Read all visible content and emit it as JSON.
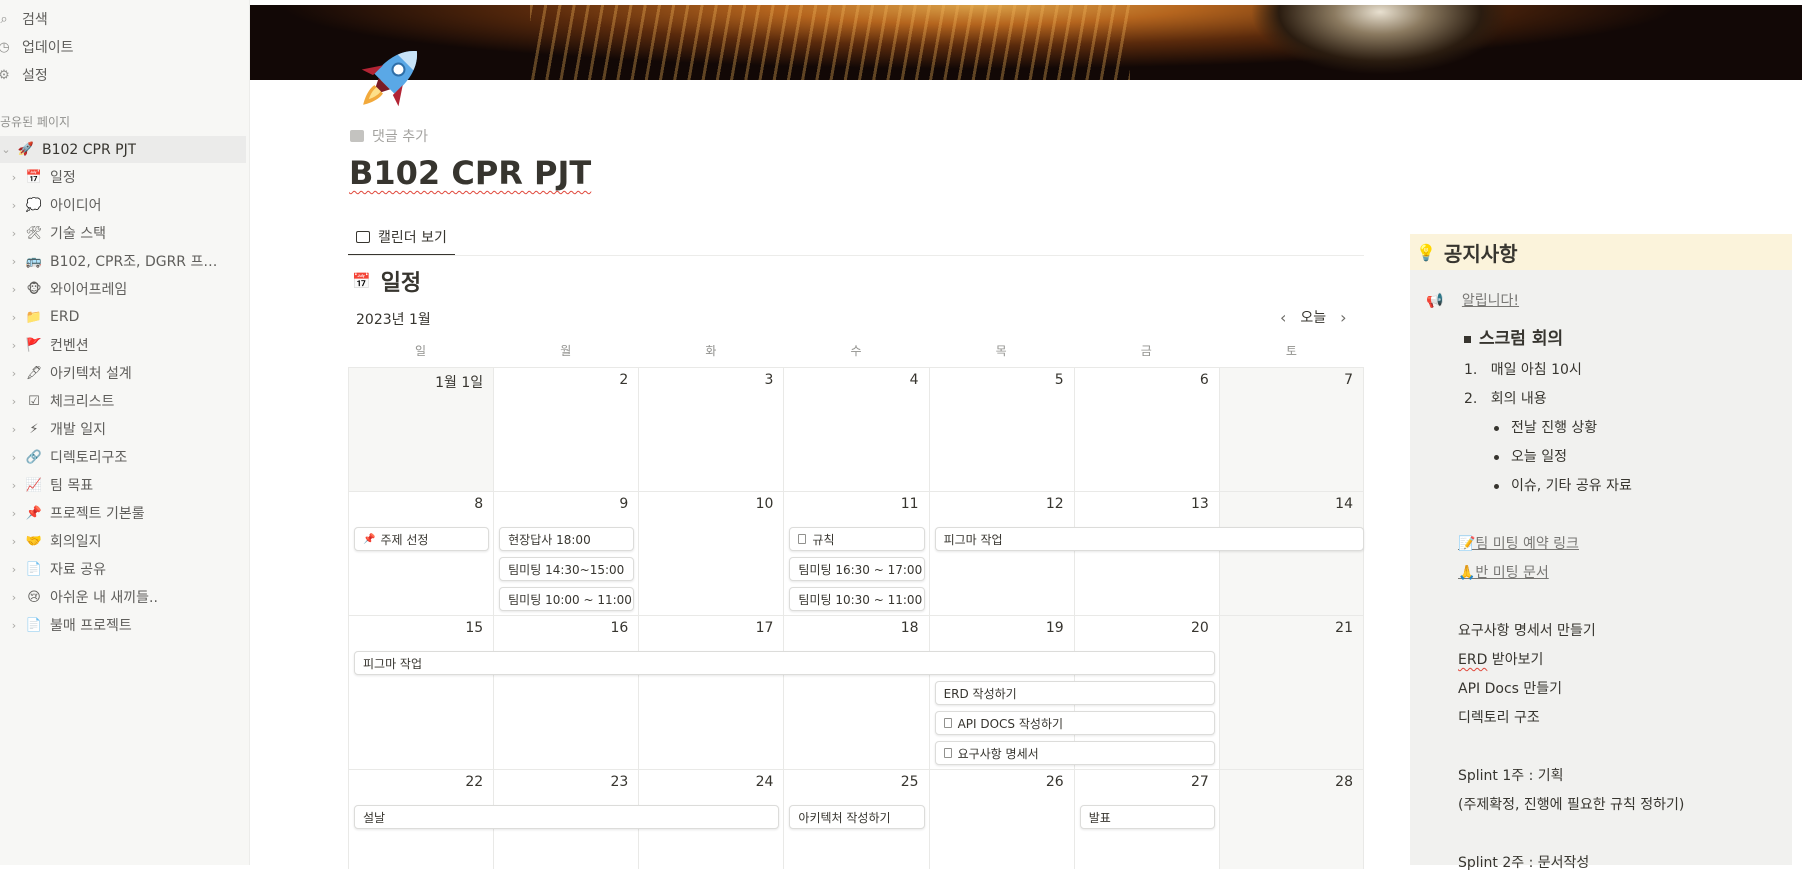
{
  "sidebar": {
    "top_items": [
      {
        "icon": "search-icon",
        "label": "검색"
      },
      {
        "icon": "clock-icon",
        "label": "업데이트"
      },
      {
        "icon": "gear-icon",
        "label": "설정"
      }
    ],
    "section_label": "공유된 페이지",
    "root": {
      "emoji": "🚀",
      "label": "B102 CPR PJT"
    },
    "items": [
      {
        "emoji": "📅",
        "label": "일정"
      },
      {
        "emoji": "💭",
        "label": "아이디어"
      },
      {
        "emoji": "🛠",
        "label": "기술 스택"
      },
      {
        "emoji": "🚌",
        "label": "B102, CPR조, DGRR 프로젝..."
      },
      {
        "emoji": "🐵",
        "label": "와이어프레임"
      },
      {
        "emoji": "📁",
        "label": "ERD"
      },
      {
        "emoji": "🚩",
        "label": "컨벤션"
      },
      {
        "emoji": "🖋",
        "label": "아키텍처 설계"
      },
      {
        "emoji": "☑",
        "label": "체크리스트"
      },
      {
        "emoji": "⚡",
        "label": "개발 일지"
      },
      {
        "emoji": "🔗",
        "label": "디렉토리구조"
      },
      {
        "emoji": "📈",
        "label": "팀 목표"
      },
      {
        "emoji": "📌",
        "label": "프로젝트 기본룰"
      },
      {
        "emoji": "🤝",
        "label": "회의일지"
      },
      {
        "emoji": "📄",
        "label": "자료 공유"
      },
      {
        "emoji": "😢",
        "label": "아쉬운 내 새끼들.."
      },
      {
        "emoji": "📄",
        "label": "불매 프로젝트"
      }
    ]
  },
  "page": {
    "add_comment": "댓글 추가",
    "title": "B102 CPR PJT",
    "view_tab": "캘린더 보기",
    "db_emoji": "📅",
    "db_title": "일정"
  },
  "calendar": {
    "month": "2023년 1월",
    "today": "오늘",
    "weekdays": [
      "일",
      "월",
      "화",
      "수",
      "목",
      "금",
      "토"
    ],
    "weeks": [
      [
        "1월 1일",
        "2",
        "3",
        "4",
        "5",
        "6",
        "7"
      ],
      [
        "8",
        "9",
        "10",
        "11",
        "12",
        "13",
        "14"
      ],
      [
        "15",
        "16",
        "17",
        "18",
        "19",
        "20",
        "21"
      ],
      [
        "22",
        "23",
        "24",
        "25",
        "26",
        "27",
        "28"
      ]
    ],
    "events": [
      {
        "week": 1,
        "start": 0,
        "span": 1,
        "slot": 0,
        "icon": "pin",
        "label": "주제 선정"
      },
      {
        "week": 1,
        "start": 1,
        "span": 1,
        "slot": 0,
        "icon": "",
        "label": "현장답사 18:00"
      },
      {
        "week": 1,
        "start": 1,
        "span": 1,
        "slot": 1,
        "icon": "",
        "label": "팀미팅 14:30~15:00"
      },
      {
        "week": 1,
        "start": 1,
        "span": 1,
        "slot": 2,
        "icon": "",
        "label": "팀미팅 10:00 ~ 11:00"
      },
      {
        "week": 1,
        "start": 3,
        "span": 1,
        "slot": 0,
        "icon": "doc",
        "label": "규칙"
      },
      {
        "week": 1,
        "start": 3,
        "span": 1,
        "slot": 1,
        "icon": "",
        "label": "팀미팅 16:30 ~ 17:00"
      },
      {
        "week": 1,
        "start": 3,
        "span": 1,
        "slot": 2,
        "icon": "",
        "label": "팀미팅 10:30 ~ 11:00"
      },
      {
        "week": 1,
        "start": 4,
        "span": 3,
        "slot": 0,
        "icon": "",
        "label": "피그마 작업"
      },
      {
        "week": 2,
        "start": 0,
        "span": 6,
        "slot": 0,
        "icon": "",
        "label": "피그마 작업"
      },
      {
        "week": 2,
        "start": 4,
        "span": 2,
        "slot": 1,
        "icon": "",
        "label": "ERD 작성하기"
      },
      {
        "week": 2,
        "start": 4,
        "span": 2,
        "slot": 2,
        "icon": "doc",
        "label": "API DOCS 작성하기"
      },
      {
        "week": 2,
        "start": 4,
        "span": 2,
        "slot": 3,
        "icon": "doc",
        "label": "요구사항 명세서"
      },
      {
        "week": 3,
        "start": 0,
        "span": 3,
        "slot": 0,
        "icon": "",
        "label": "설날"
      },
      {
        "week": 3,
        "start": 3,
        "span": 1,
        "slot": 0,
        "icon": "",
        "label": "아키텍처 작성하기"
      },
      {
        "week": 3,
        "start": 5,
        "span": 1,
        "slot": 0,
        "icon": "",
        "label": "발표"
      }
    ]
  },
  "notice": {
    "emoji": "💡",
    "title": "공지사항",
    "announce_emoji": "📢",
    "announce": "알립니다!",
    "scrum_title": "스크럼 회의",
    "list1": "매일 아침 10시",
    "list2": "회의 내용",
    "bullets": [
      "전날 진행 상황",
      "오늘 일정",
      "이슈, 기타 공유 자료"
    ],
    "link1": "📝팀 미팅 예약 링크",
    "link2": "🙏반 미팅 문서",
    "todo1": "요구사항 명세서 만들기",
    "todo2_a": "ERD",
    "todo2_b": " 받아보기",
    "todo3": "API Docs 만들기",
    "todo4": "디렉토리 구조",
    "splint1": "Splint 1주 : 기획",
    "splint1_note": "(주제확정, 진행에 필요한 규칙 정하기)",
    "splint2": "Splint 2주 : 문서작성"
  }
}
